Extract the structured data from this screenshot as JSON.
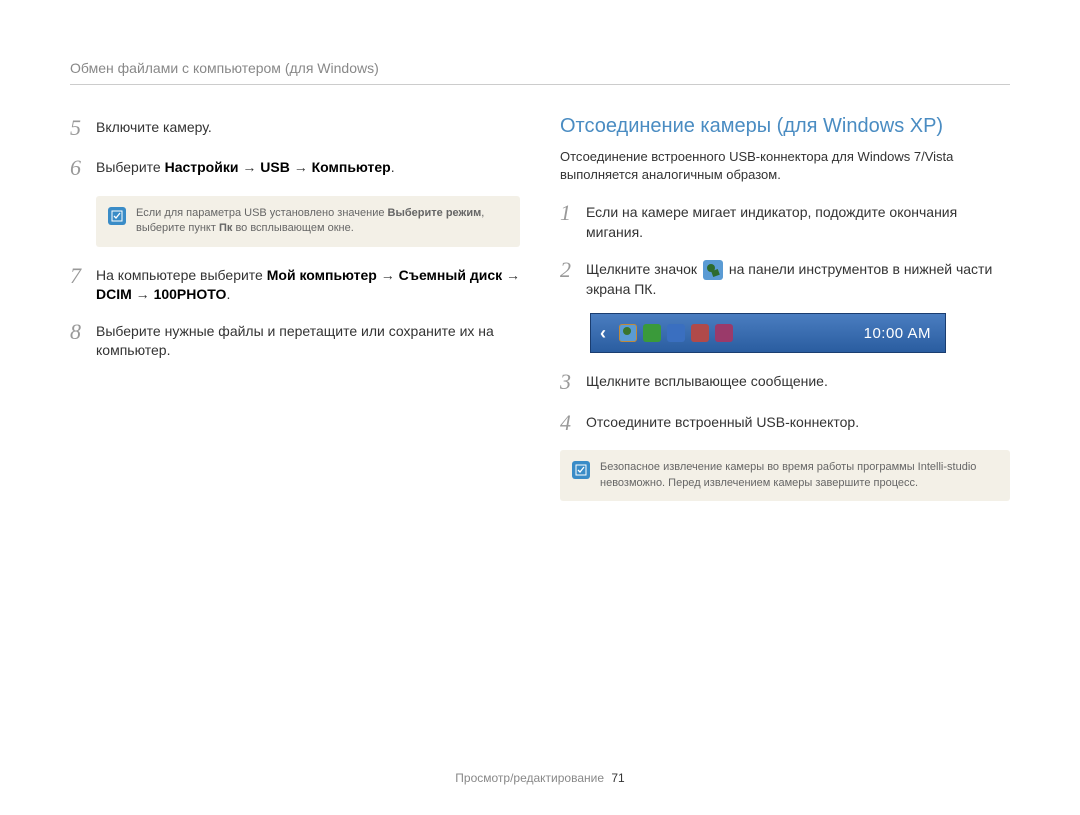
{
  "header": {
    "title": "Обмен файлами с компьютером (для Windows)"
  },
  "left": {
    "steps": [
      {
        "num": "5",
        "text": "Включите камеру."
      },
      {
        "num": "6",
        "prefix": "Выберите ",
        "b1": "Настройки",
        "arrow": " → ",
        "b2": "USB",
        "b3": "Компьютер",
        "suffix": "."
      },
      {
        "num": "7",
        "prefix": "На компьютере выберите ",
        "b1": "Мой компьютер",
        "arrow": " → ",
        "b2": "Съемный диск",
        "b3": "DCIM",
        "b4": "100PHOTO",
        "suffix": "."
      },
      {
        "num": "8",
        "text": "Выберите нужные файлы и перетащите или сохраните их на компьютер."
      }
    ],
    "note": {
      "prefix": "Если для параметра USB установлено значение ",
      "b1": "Выберите режим",
      "mid": ", выберите пункт ",
      "b2": "Пк",
      "suffix": " во всплывающем окне."
    }
  },
  "right": {
    "title": "Отсоединение камеры (для Windows XP)",
    "subtitle": "Отсоединение встроенного USB-коннектора для Windows 7/Vista выполняется аналогичным образом.",
    "steps": [
      {
        "num": "1",
        "text": "Если на камере мигает индикатор, подождите окончания мигания."
      },
      {
        "num": "2",
        "pre": "Щелкните значок ",
        "post": " на панели инструментов в нижней части экрана ПК."
      },
      {
        "num": "3",
        "text": "Щелкните всплывающее сообщение."
      },
      {
        "num": "4",
        "text": "Отсоедините встроенный USB-коннектор."
      }
    ],
    "taskbar": {
      "time": "10:00 AM"
    },
    "note": {
      "text": "Безопасное извлечение камеры во время работы программы Intelli-studio невозможно. Перед извлечением камеры завершите процесс."
    }
  },
  "footer": {
    "section": "Просмотр/редактирование",
    "page": "71"
  }
}
